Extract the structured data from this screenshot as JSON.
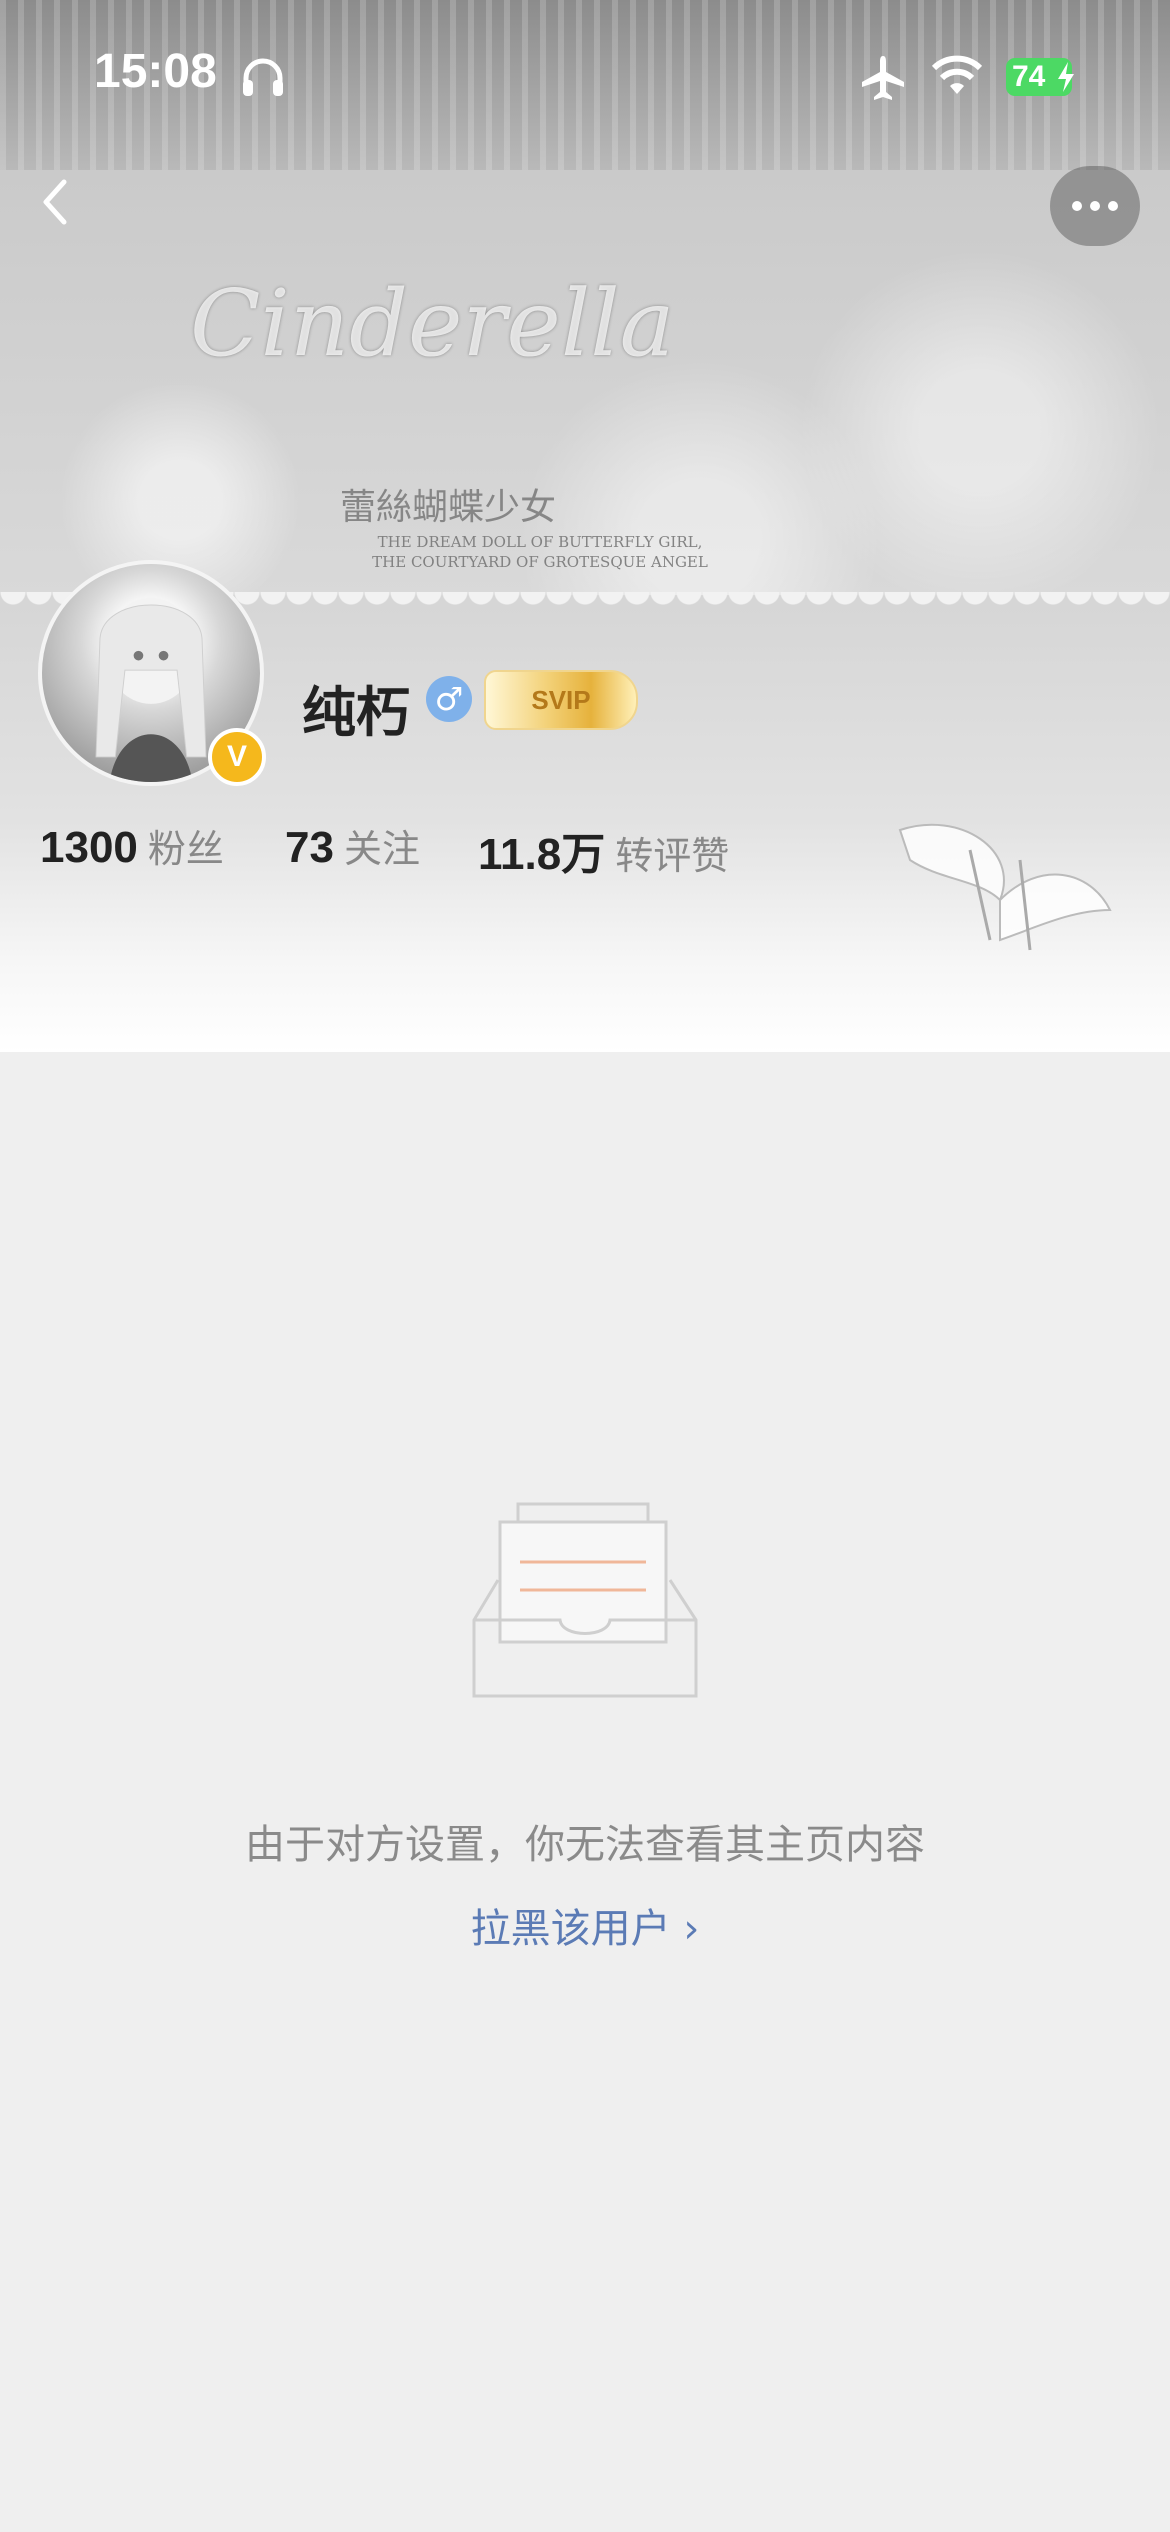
{
  "status_bar": {
    "time": "15:08",
    "battery_percent": "74",
    "icons": [
      "headphone-icon",
      "airplane-icon",
      "wifi-icon",
      "battery-icon",
      "charging-bolt-icon"
    ]
  },
  "nav": {
    "back_icon": "chevron-left-icon",
    "more_icon": "more-dots-icon"
  },
  "banner": {
    "script_text": "Cinderella",
    "cn_text": "蕾絲蝴蝶少女",
    "en_text": "THE DREAM DOLL OF BUTTERFLY GIRL, THE COURTYARD OF GROTESQUE ANGEL"
  },
  "profile": {
    "name": "纯朽",
    "gender": "♂",
    "verified_mark": "V",
    "vip_label": "SVIP"
  },
  "stats": [
    {
      "value": "1300",
      "label": "粉丝"
    },
    {
      "value": "73",
      "label": "关注"
    },
    {
      "value": "11.8万",
      "label": "转评赞"
    }
  ],
  "empty_state": {
    "message": "由于对方设置，你无法查看其主页内容",
    "action_label": "拉黑该用户",
    "action_chevron": "›"
  },
  "colors": {
    "link": "#5b7bb5",
    "battery": "#4cd964",
    "verified": "#f5b81c",
    "gender": "#7fb1ea",
    "background": "#efefef"
  }
}
